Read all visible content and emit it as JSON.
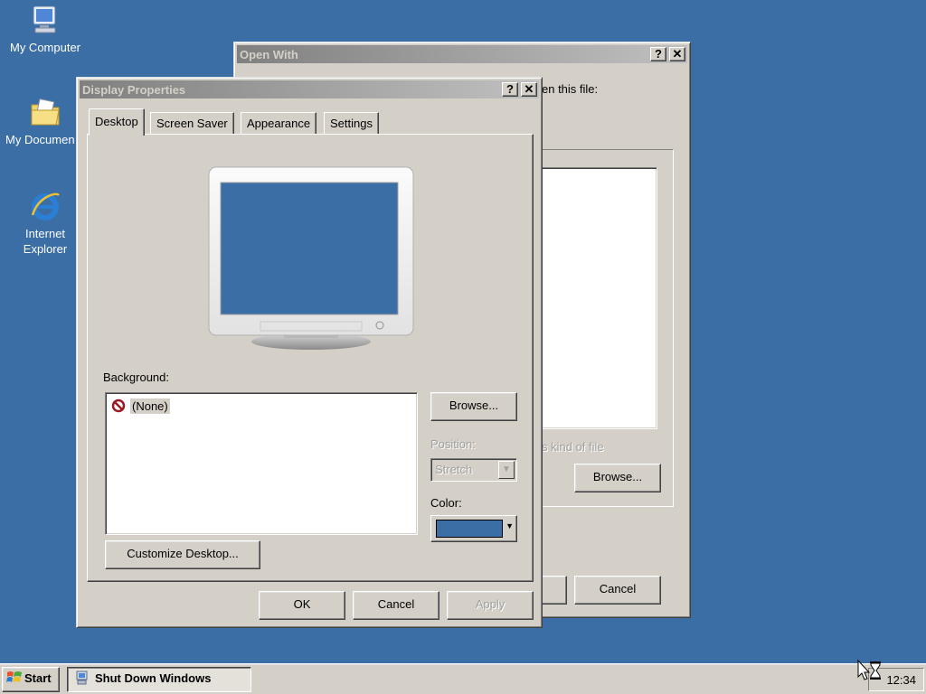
{
  "desktop": {
    "icons": [
      {
        "label": "My Computer"
      },
      {
        "label": "My Documen"
      },
      {
        "label": "Internet Explorer"
      }
    ]
  },
  "open_with": {
    "title": "Open With",
    "help_glyph": "?",
    "close_glyph": "✕",
    "prompt_partial": "en this file:",
    "hint_partial": "s kind of file",
    "browse_label": "Browse...",
    "cancel_label": "Cancel"
  },
  "display_properties": {
    "title": "Display Properties",
    "help_glyph": "?",
    "close_glyph": "✕",
    "tabs": [
      {
        "label": "Desktop",
        "active": true
      },
      {
        "label": "Screen Saver",
        "active": false
      },
      {
        "label": "Appearance",
        "active": false
      },
      {
        "label": "Settings",
        "active": false
      }
    ],
    "background_label": "Background:",
    "background_items": [
      {
        "label": "(None)",
        "icon": "none-icon",
        "selected": true
      }
    ],
    "browse_label": "Browse...",
    "position_label": "Position:",
    "position_value": "Stretch",
    "color_label": "Color:",
    "color_value": "#3a6ea5",
    "customize_label": "Customize Desktop...",
    "ok_label": "OK",
    "cancel_label": "Cancel",
    "apply_label": "Apply"
  },
  "taskbar": {
    "start_label": "Start",
    "task_label": "Shut Down Windows",
    "clock": "12:34"
  },
  "colors": {
    "desktop": "#3a6ea5",
    "face": "#d4d0c8",
    "inactive_title_start": "#808080",
    "inactive_title_end": "#c0c0c0"
  }
}
